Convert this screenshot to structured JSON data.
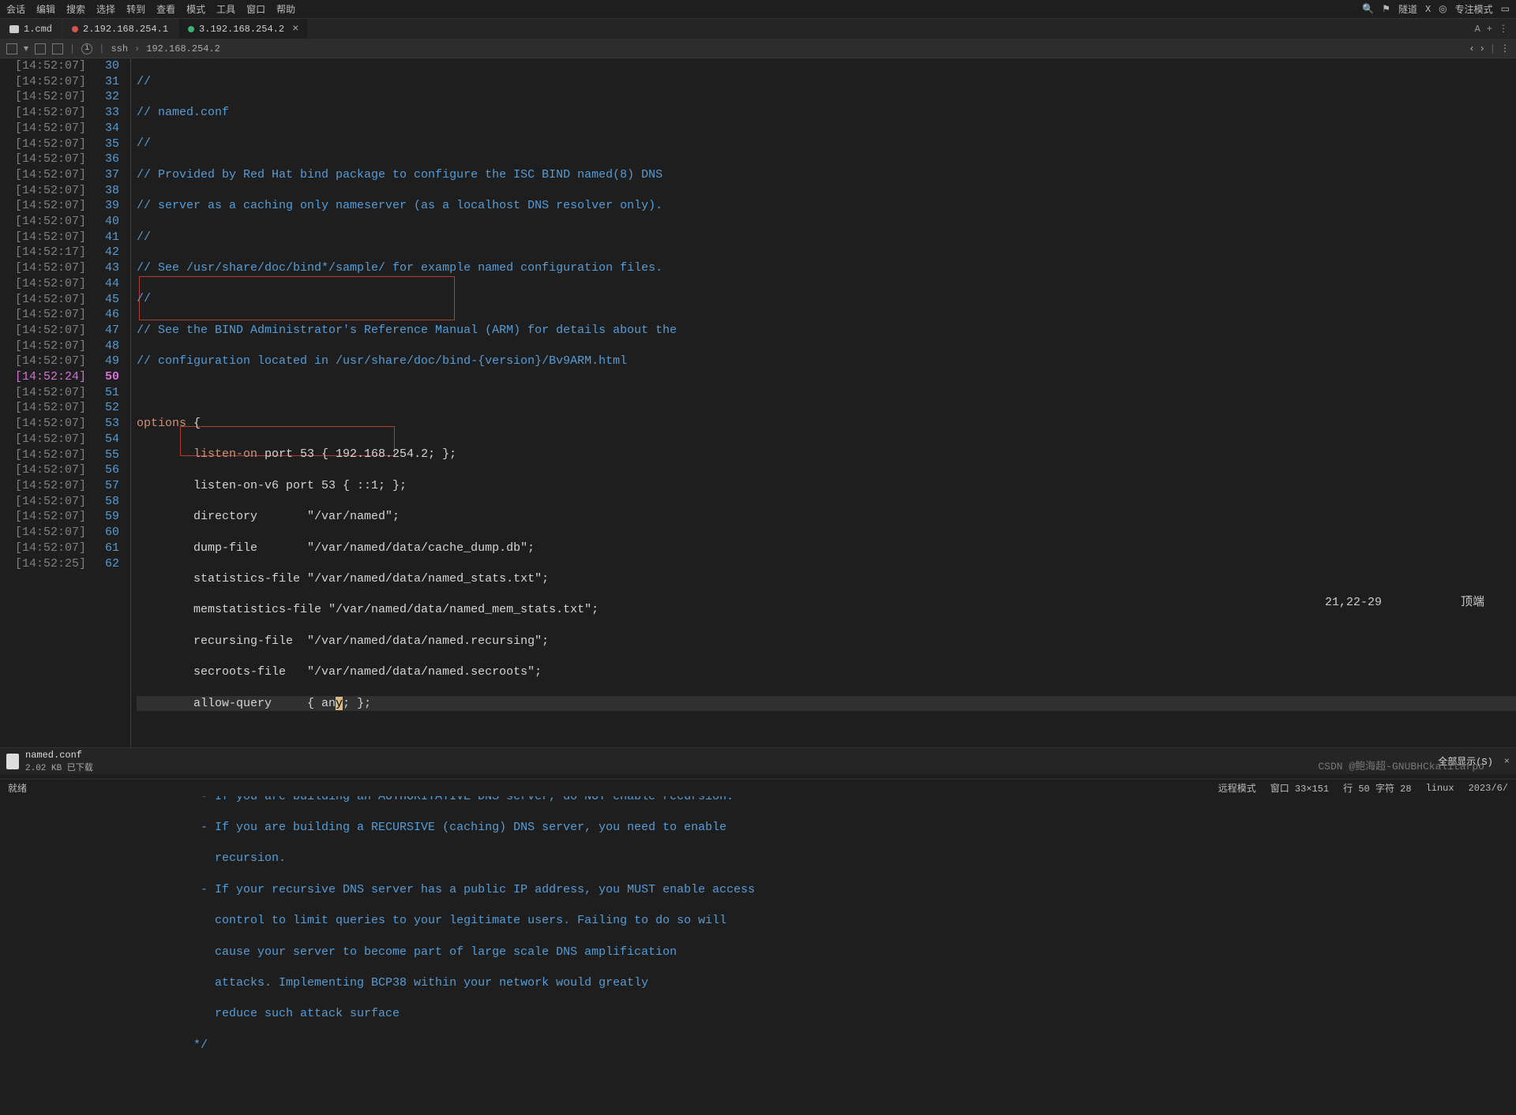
{
  "menu": {
    "items": [
      "会话",
      "编辑",
      "搜索",
      "选择",
      "转到",
      "查看",
      "模式",
      "工具",
      "窗口",
      "帮助"
    ],
    "right": {
      "tunnel": "隧道",
      "x": "X",
      "focus": "专注模式"
    }
  },
  "tabs": {
    "t0": {
      "label": "1.cmd"
    },
    "t1": {
      "label": "2.192.168.254.1"
    },
    "t2": {
      "label": "3.192.168.254.2"
    },
    "tools": {
      "a": "A",
      "plus": "+",
      "dots": "⋮"
    }
  },
  "toolbar": {
    "ssh": "ssh",
    "addr": "192.168.254.2"
  },
  "timestamps": [
    "[14:52:07]",
    "[14:52:07]",
    "[14:52:07]",
    "[14:52:07]",
    "[14:52:07]",
    "[14:52:07]",
    "[14:52:07]",
    "[14:52:07]",
    "[14:52:07]",
    "[14:52:07]",
    "[14:52:07]",
    "[14:52:07]",
    "[14:52:17]",
    "[14:52:07]",
    "[14:52:07]",
    "[14:52:07]",
    "[14:52:07]",
    "[14:52:07]",
    "[14:52:07]",
    "[14:52:07]",
    "[14:52:24]",
    "[14:52:07]",
    "[14:52:07]",
    "[14:52:07]",
    "[14:52:07]",
    "[14:52:07]",
    "[14:52:07]",
    "[14:52:07]",
    "[14:52:07]",
    "[14:52:07]",
    "[14:52:07]",
    "[14:52:07]",
    "[14:52:25]"
  ],
  "ts_hl_index": 20,
  "linenos": [
    "30",
    "31",
    "32",
    "33",
    "34",
    "35",
    "36",
    "37",
    "38",
    "39",
    "40",
    "41",
    "42",
    "43",
    "44",
    "45",
    "46",
    "47",
    "48",
    "49",
    "50",
    "51",
    "52",
    "53",
    "54",
    "55",
    "56",
    "57",
    "58",
    "59",
    "60",
    "61",
    "62"
  ],
  "ln_hl_index": 20,
  "code": {
    "c0": "//",
    "c1": "// named.conf",
    "c2": "//",
    "c3": "// Provided by Red Hat bind package to configure the ISC BIND named(8) DNS",
    "c4": "// server as a caching only nameserver (as a localhost DNS resolver only).",
    "c5": "//",
    "c6": "// See /usr/share/doc/bind*/sample/ for example named configuration files.",
    "c7": "//",
    "c8": "// See the BIND Administrator's Reference Manual (ARM) for details about the",
    "c9": "// configuration located in /usr/share/doc/bind-{version}/Bv9ARM.html",
    "c10": "",
    "c11_a": "options",
    "c11_b": " {",
    "c12_a": "        ",
    "c12_b": "listen-on",
    "c12_c": " port 53 { 192.168.254.2; };",
    "c13": "        listen-on-v6 port 53 { ::1; };",
    "c14": "        directory       \"/var/named\";",
    "c15": "        dump-file       \"/var/named/data/cache_dump.db\";",
    "c16": "        statistics-file \"/var/named/data/named_stats.txt\";",
    "c17": "        memstatistics-file \"/var/named/data/named_mem_stats.txt\";",
    "c18": "        recursing-file  \"/var/named/data/named.recursing\";",
    "c19": "        secroots-file   \"/var/named/data/named.secroots\";",
    "c20_a": "        allow-query     { an",
    "c20_cur": "y",
    "c20_b": "; };",
    "c21": "",
    "c22": "        /*",
    "c23": "         - If you are building an AUTHORITATIVE DNS server, do NOT enable recursion.",
    "c24": "         - If you are building a RECURSIVE (caching) DNS server, you need to enable",
    "c25": "           recursion.",
    "c26": "         - If your recursive DNS server has a public IP address, you MUST enable access",
    "c27": "           control to limit queries to your legitimate users. Failing to do so will",
    "c28": "           cause your server to become part of large scale DNS amplification",
    "c29": "           attacks. Implementing BCP38 within your network would greatly",
    "c30": "           reduce such attack surface",
    "c31": "        */",
    "c32": ""
  },
  "vim": {
    "pos": "21,22-29",
    "mode": "顶端"
  },
  "download": {
    "name": "named.conf",
    "meta": "2.02 KB 已下载",
    "showall": "全部显示(S)"
  },
  "status": {
    "ready": "就绪",
    "remote": "远程模式",
    "win": "窗口 33×151",
    "rc": "行 50 字符 28",
    "lang": "linux",
    "date": "2023/6/"
  },
  "watermark": "CSDN @鲍海超-GNUBHCkalitarpo"
}
